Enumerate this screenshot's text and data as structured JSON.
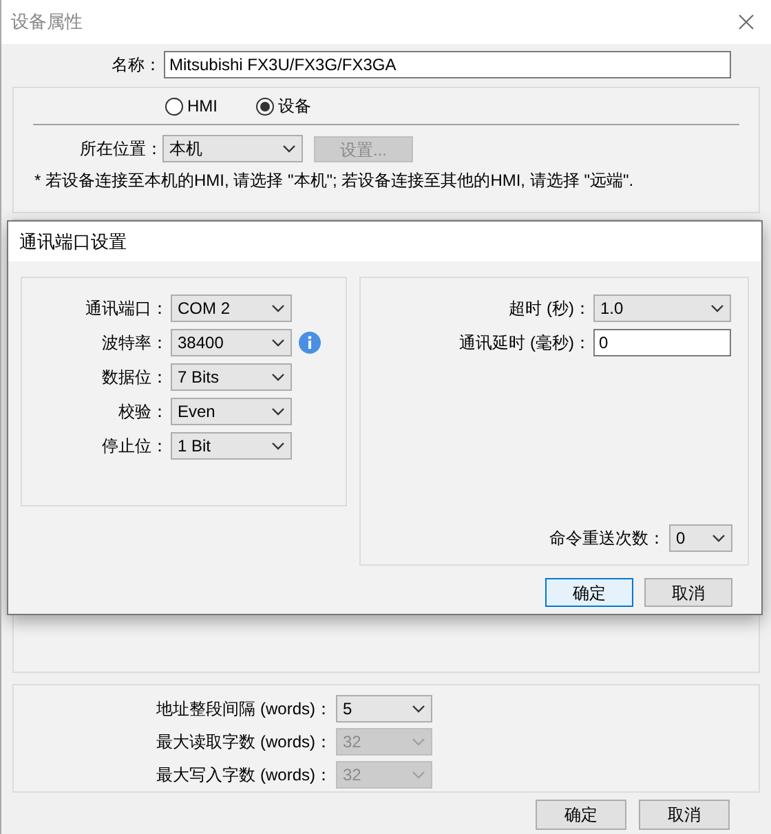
{
  "window": {
    "title": "设备属性"
  },
  "name_field": {
    "label": "名称：",
    "value": "Mitsubishi FX3U/FX3G/FX3GA"
  },
  "device_type": [
    {
      "label": "HMI",
      "selected": false
    },
    {
      "label": "设备",
      "selected": true
    }
  ],
  "location": {
    "label": "所在位置：",
    "value": "本机",
    "settings_button": {
      "label": "设置...",
      "disabled": true
    }
  },
  "note": "* 若设备连接至本机的HMI, 请选择 \"本机\"; 若设备连接至其他的HMI, 请选择 \"远端\".",
  "address_settings": [
    {
      "label": "地址整段间隔 (words)：",
      "value": "5",
      "disabled": false
    },
    {
      "label": "最大读取字数 (words)：",
      "value": "32",
      "disabled": true
    },
    {
      "label": "最大写入字数 (words)：",
      "value": "32",
      "disabled": true
    }
  ],
  "buttons": [
    {
      "label": "确定"
    },
    {
      "label": "取消"
    }
  ],
  "port_dialog": {
    "title": "通讯端口设置",
    "left_fields": [
      {
        "label": "通讯端口：",
        "value": "COM 2",
        "info": false
      },
      {
        "label": "波特率：",
        "value": "38400",
        "info": true
      },
      {
        "label": "数据位：",
        "value": "7 Bits",
        "info": false
      },
      {
        "label": "校验：",
        "value": "Even",
        "info": false
      },
      {
        "label": "停止位：",
        "value": "1 Bit",
        "info": false
      }
    ],
    "right_fields": [
      {
        "kind": "select",
        "label": "超时 (秒)：",
        "value": "1.0"
      },
      {
        "kind": "input",
        "label": "通讯延时 (毫秒)：",
        "value": "0"
      }
    ],
    "retry": {
      "label": "命令重送次数：",
      "value": "0"
    },
    "buttons": [
      {
        "label": "确定",
        "focused": true
      },
      {
        "label": "取消",
        "focused": false
      }
    ]
  }
}
